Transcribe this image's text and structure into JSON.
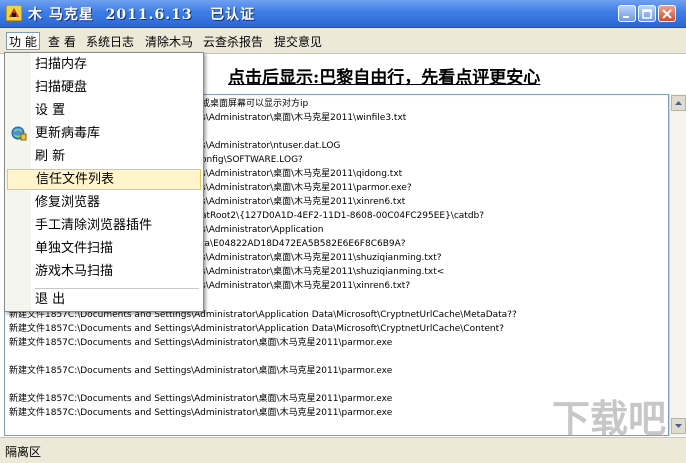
{
  "window": {
    "title": "木 马克星  2011.6.13   已认证",
    "accent_color": "#3e7de6"
  },
  "menubar": {
    "items": [
      "功 能",
      "查 看",
      "系统日志",
      "清除木马",
      "云查杀报告",
      "提交意见"
    ]
  },
  "headline": "点击后显示:巴黎自由行，先看点评更安心",
  "dropdown": {
    "items": [
      "扫描内存",
      "扫描硬盘",
      "设 置",
      "更新病毒库",
      "刷 新",
      "信任文件列表",
      "修复浏览器",
      "手工清除浏览器插件",
      "单独文件扫描",
      "游戏木马扫描",
      "退 出"
    ],
    "highlighted": "信任文件列表"
  },
  "log_lines": [
    "或桌面屏幕可以显示对方ip",
    "s\\Administrator\\桌面\\木马克星2011\\winfile3.txt",
    "",
    "s\\Administrator\\ntuser.dat.LOG",
    "onfig\\SOFTWARE.LOG?",
    "s\\Administrator\\桌面\\木马克星2011\\qidong.txt",
    "s\\Administrator\\桌面\\木马克星2011\\parmor.exe?",
    "s\\Administrator\\桌面\\木马克星2011\\xinren6.txt",
    "atRoot2\\{127D0A1D-4EF2-11D1-8608-00C04FC295EE}\\catdb?",
    "s\\Administrator\\Application",
    "ta\\E04822AD18D472EA5B582E6E6F8C6B9A?",
    "s\\Administrator\\桌面\\木马克星2011\\shuziqianming.txt?",
    "s\\Administrator\\桌面\\木马克星2011\\shuziqianming.txt<",
    "s\\Administrator\\桌面\\木马克星2011\\xinren6.txt?",
    "",
    "新建文件1857C:\\Documents and Settings\\Administrator\\Application Data\\Microsoft\\CryptnetUrlCache\\MetaData??",
    "新建文件1857C:\\Documents and Settings\\Administrator\\Application Data\\Microsoft\\CryptnetUrlCache\\Content?",
    "新建文件1857C:\\Documents and Settings\\Administrator\\桌面\\木马克星2011\\parmor.exe",
    "",
    "新建文件1857C:\\Documents and Settings\\Administrator\\桌面\\木马克星2011\\parmor.exe",
    "",
    "新建文件1857C:\\Documents and Settings\\Administrator\\桌面\\木马克星2011\\parmor.exe",
    "新建文件1857C:\\Documents and Settings\\Administrator\\桌面\\木马克星2011\\parmor.exe"
  ],
  "statusbar": {
    "text": "隔离区"
  },
  "watermark": {
    "text": "下载吧"
  }
}
